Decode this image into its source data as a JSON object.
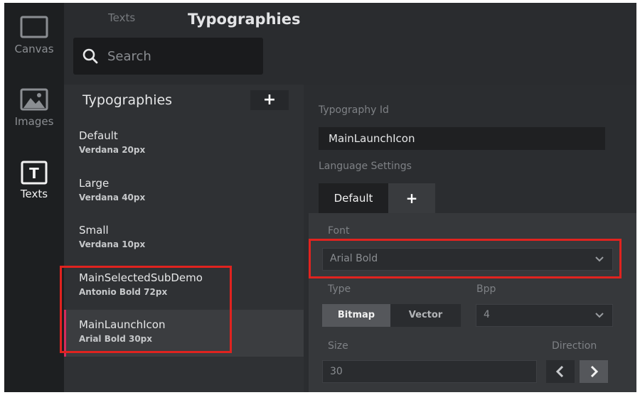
{
  "sidebar": {
    "items": [
      {
        "label": "Canvas",
        "icon": "canvas-icon",
        "active": false
      },
      {
        "label": "Images",
        "icon": "image-icon",
        "active": false
      },
      {
        "label": "Texts",
        "icon": "text-icon",
        "active": true
      }
    ]
  },
  "header": {
    "tab_texts": "Texts",
    "title": "Typographies",
    "search_placeholder": "Search"
  },
  "list": {
    "title": "Typographies",
    "add_label": "+",
    "items": [
      {
        "name": "Default",
        "sub": "Verdana  20px",
        "selected": false
      },
      {
        "name": "Large",
        "sub": "Verdana  40px",
        "selected": false
      },
      {
        "name": "Small",
        "sub": "Verdana  10px",
        "selected": false
      },
      {
        "name": "MainSelectedSubDemo",
        "sub": "Antonio Bold  72px",
        "selected": false
      },
      {
        "name": "MainLaunchIcon",
        "sub": "Arial Bold  30px",
        "selected": true
      }
    ]
  },
  "detail": {
    "typography_id_label": "Typography Id",
    "typography_id_value": "MainLaunchIcon",
    "language_settings_label": "Language Settings",
    "lang_tabs": {
      "default": "Default",
      "add": "+"
    },
    "font_label": "Font",
    "font_value": "Arial Bold",
    "type_label": "Type",
    "type_options": {
      "bitmap": "Bitmap",
      "vector": "Vector"
    },
    "bpp_label": "Bpp",
    "bpp_value": "4",
    "size_label": "Size",
    "size_value": "30",
    "direction_label": "Direction"
  },
  "colors": {
    "accent": "#d62a5a",
    "annotation": "#e0231f"
  }
}
